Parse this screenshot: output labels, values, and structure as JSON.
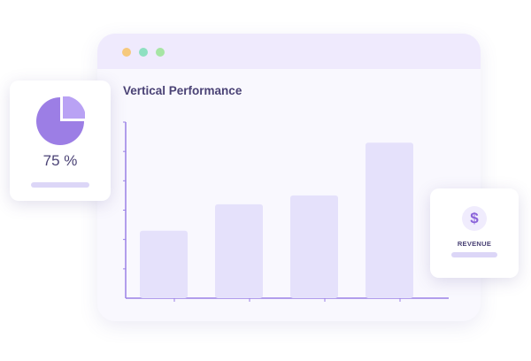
{
  "chart_data": {
    "type": "bar",
    "title": "Vertical Performance",
    "categories": [
      "",
      "",
      "",
      ""
    ],
    "values": [
      46,
      64,
      70,
      106
    ],
    "ylim": [
      0,
      120
    ],
    "grid": false,
    "colors": {
      "bar": "#e5e1fb",
      "axis": "#9a80e6"
    }
  },
  "pie_widget": {
    "value_text": "75 %",
    "percent": 75,
    "colors": {
      "main": "#9c7ee5",
      "slice": "#b9a2f4"
    }
  },
  "revenue_widget": {
    "icon": "dollar-sign-icon",
    "icon_glyph": "$",
    "label": "REVENUE"
  },
  "window": {
    "controls": [
      "orange-dot",
      "green-dot",
      "lime-dot"
    ]
  }
}
